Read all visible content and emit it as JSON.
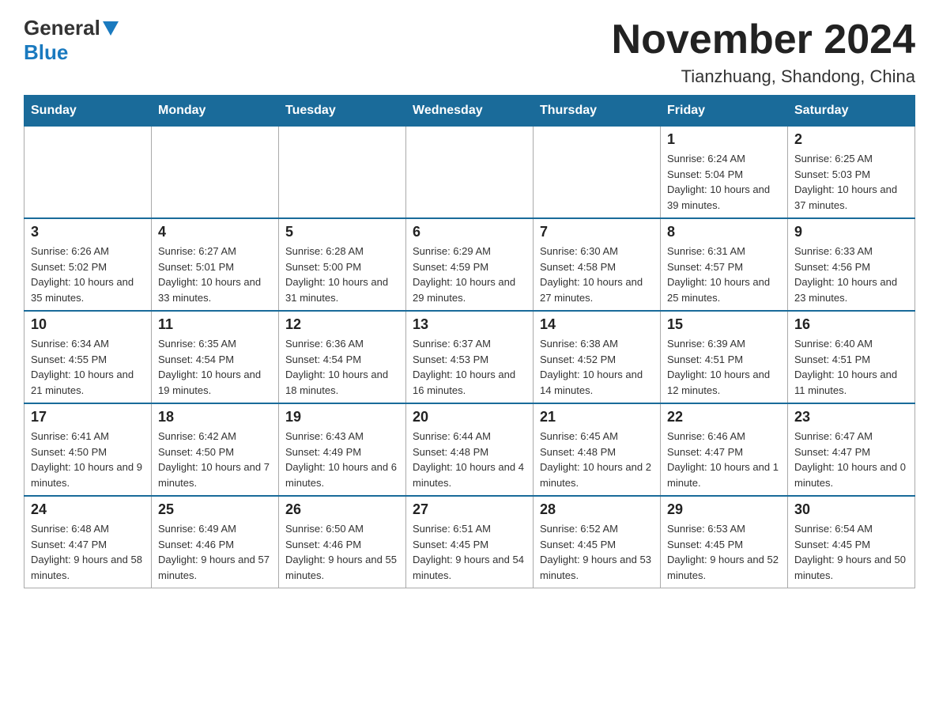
{
  "header": {
    "logo_general": "General",
    "logo_blue": "Blue",
    "title": "November 2024",
    "location": "Tianzhuang, Shandong, China"
  },
  "days_of_week": [
    "Sunday",
    "Monday",
    "Tuesday",
    "Wednesday",
    "Thursday",
    "Friday",
    "Saturday"
  ],
  "weeks": [
    [
      {
        "day": "",
        "info": ""
      },
      {
        "day": "",
        "info": ""
      },
      {
        "day": "",
        "info": ""
      },
      {
        "day": "",
        "info": ""
      },
      {
        "day": "",
        "info": ""
      },
      {
        "day": "1",
        "info": "Sunrise: 6:24 AM\nSunset: 5:04 PM\nDaylight: 10 hours and 39 minutes."
      },
      {
        "day": "2",
        "info": "Sunrise: 6:25 AM\nSunset: 5:03 PM\nDaylight: 10 hours and 37 minutes."
      }
    ],
    [
      {
        "day": "3",
        "info": "Sunrise: 6:26 AM\nSunset: 5:02 PM\nDaylight: 10 hours and 35 minutes."
      },
      {
        "day": "4",
        "info": "Sunrise: 6:27 AM\nSunset: 5:01 PM\nDaylight: 10 hours and 33 minutes."
      },
      {
        "day": "5",
        "info": "Sunrise: 6:28 AM\nSunset: 5:00 PM\nDaylight: 10 hours and 31 minutes."
      },
      {
        "day": "6",
        "info": "Sunrise: 6:29 AM\nSunset: 4:59 PM\nDaylight: 10 hours and 29 minutes."
      },
      {
        "day": "7",
        "info": "Sunrise: 6:30 AM\nSunset: 4:58 PM\nDaylight: 10 hours and 27 minutes."
      },
      {
        "day": "8",
        "info": "Sunrise: 6:31 AM\nSunset: 4:57 PM\nDaylight: 10 hours and 25 minutes."
      },
      {
        "day": "9",
        "info": "Sunrise: 6:33 AM\nSunset: 4:56 PM\nDaylight: 10 hours and 23 minutes."
      }
    ],
    [
      {
        "day": "10",
        "info": "Sunrise: 6:34 AM\nSunset: 4:55 PM\nDaylight: 10 hours and 21 minutes."
      },
      {
        "day": "11",
        "info": "Sunrise: 6:35 AM\nSunset: 4:54 PM\nDaylight: 10 hours and 19 minutes."
      },
      {
        "day": "12",
        "info": "Sunrise: 6:36 AM\nSunset: 4:54 PM\nDaylight: 10 hours and 18 minutes."
      },
      {
        "day": "13",
        "info": "Sunrise: 6:37 AM\nSunset: 4:53 PM\nDaylight: 10 hours and 16 minutes."
      },
      {
        "day": "14",
        "info": "Sunrise: 6:38 AM\nSunset: 4:52 PM\nDaylight: 10 hours and 14 minutes."
      },
      {
        "day": "15",
        "info": "Sunrise: 6:39 AM\nSunset: 4:51 PM\nDaylight: 10 hours and 12 minutes."
      },
      {
        "day": "16",
        "info": "Sunrise: 6:40 AM\nSunset: 4:51 PM\nDaylight: 10 hours and 11 minutes."
      }
    ],
    [
      {
        "day": "17",
        "info": "Sunrise: 6:41 AM\nSunset: 4:50 PM\nDaylight: 10 hours and 9 minutes."
      },
      {
        "day": "18",
        "info": "Sunrise: 6:42 AM\nSunset: 4:50 PM\nDaylight: 10 hours and 7 minutes."
      },
      {
        "day": "19",
        "info": "Sunrise: 6:43 AM\nSunset: 4:49 PM\nDaylight: 10 hours and 6 minutes."
      },
      {
        "day": "20",
        "info": "Sunrise: 6:44 AM\nSunset: 4:48 PM\nDaylight: 10 hours and 4 minutes."
      },
      {
        "day": "21",
        "info": "Sunrise: 6:45 AM\nSunset: 4:48 PM\nDaylight: 10 hours and 2 minutes."
      },
      {
        "day": "22",
        "info": "Sunrise: 6:46 AM\nSunset: 4:47 PM\nDaylight: 10 hours and 1 minute."
      },
      {
        "day": "23",
        "info": "Sunrise: 6:47 AM\nSunset: 4:47 PM\nDaylight: 10 hours and 0 minutes."
      }
    ],
    [
      {
        "day": "24",
        "info": "Sunrise: 6:48 AM\nSunset: 4:47 PM\nDaylight: 9 hours and 58 minutes."
      },
      {
        "day": "25",
        "info": "Sunrise: 6:49 AM\nSunset: 4:46 PM\nDaylight: 9 hours and 57 minutes."
      },
      {
        "day": "26",
        "info": "Sunrise: 6:50 AM\nSunset: 4:46 PM\nDaylight: 9 hours and 55 minutes."
      },
      {
        "day": "27",
        "info": "Sunrise: 6:51 AM\nSunset: 4:45 PM\nDaylight: 9 hours and 54 minutes."
      },
      {
        "day": "28",
        "info": "Sunrise: 6:52 AM\nSunset: 4:45 PM\nDaylight: 9 hours and 53 minutes."
      },
      {
        "day": "29",
        "info": "Sunrise: 6:53 AM\nSunset: 4:45 PM\nDaylight: 9 hours and 52 minutes."
      },
      {
        "day": "30",
        "info": "Sunrise: 6:54 AM\nSunset: 4:45 PM\nDaylight: 9 hours and 50 minutes."
      }
    ]
  ]
}
